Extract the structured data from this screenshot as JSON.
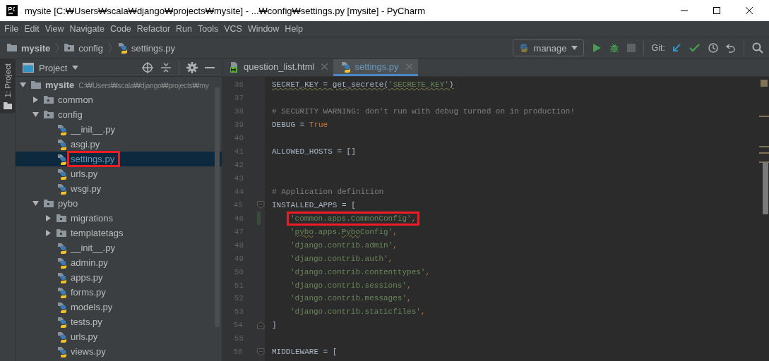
{
  "window": {
    "title": "mysite [C:₩Users₩scala₩django₩projects₩mysite] - ...₩config₩settings.py [mysite] - PyCharm"
  },
  "menu": [
    "File",
    "Edit",
    "View",
    "Navigate",
    "Code",
    "Refactor",
    "Run",
    "Tools",
    "VCS",
    "Window",
    "Help"
  ],
  "breadcrumbs": [
    {
      "label": "mysite",
      "kind": "project"
    },
    {
      "label": "config",
      "kind": "folder"
    },
    {
      "label": "settings.py",
      "kind": "python"
    }
  ],
  "run_config": {
    "label": "manage"
  },
  "git_label": "Git:",
  "tool_stripe": {
    "label": "1: Project",
    "selected": true
  },
  "project_panel": {
    "title": "Project",
    "tree": [
      {
        "label": "mysite",
        "kind": "root",
        "path": "C:₩Users₩scala₩django₩projects₩my",
        "expanded": true,
        "selected": false,
        "children": [
          {
            "label": "common",
            "kind": "folder",
            "expanded": false,
            "selected": false
          },
          {
            "label": "config",
            "kind": "folder",
            "expanded": true,
            "selected": false,
            "children": [
              {
                "label": "__init__.py",
                "kind": "python",
                "selected": false
              },
              {
                "label": "asgi.py",
                "kind": "python",
                "selected": false
              },
              {
                "label": "settings.py",
                "kind": "python",
                "selected": true,
                "annotated": true
              },
              {
                "label": "urls.py",
                "kind": "python",
                "selected": false
              },
              {
                "label": "wsgi.py",
                "kind": "python",
                "selected": false
              }
            ]
          },
          {
            "label": "pybo",
            "kind": "folder",
            "expanded": true,
            "selected": false,
            "children": [
              {
                "label": "migrations",
                "kind": "folder",
                "expanded": false,
                "selected": false
              },
              {
                "label": "templatetags",
                "kind": "folder",
                "expanded": false,
                "selected": false
              },
              {
                "label": "__init__.py",
                "kind": "python",
                "selected": false
              },
              {
                "label": "admin.py",
                "kind": "python",
                "selected": false
              },
              {
                "label": "apps.py",
                "kind": "python",
                "selected": false
              },
              {
                "label": "forms.py",
                "kind": "python",
                "selected": false
              },
              {
                "label": "models.py",
                "kind": "python",
                "selected": false
              },
              {
                "label": "tests.py",
                "kind": "python",
                "selected": false
              },
              {
                "label": "urls.py",
                "kind": "python",
                "selected": false
              },
              {
                "label": "views.py",
                "kind": "python",
                "selected": false
              }
            ]
          }
        ]
      }
    ]
  },
  "tabs": [
    {
      "label": "question_list.html",
      "kind": "html",
      "selected": false
    },
    {
      "label": "settings.py",
      "kind": "python",
      "selected": true
    }
  ],
  "editor": {
    "lines": [
      {
        "number": "36",
        "segments": [
          {
            "text": "SECRET_KEY = get_secrete(",
            "kind": "plain",
            "wavy": true
          },
          {
            "text": "'SECRETE_KEY'",
            "kind": "string",
            "wavy": true
          },
          {
            "text": ")",
            "kind": "plain",
            "wavy": true
          }
        ]
      },
      {
        "number": "37"
      },
      {
        "number": "38",
        "segments": [
          {
            "text": "# SECURITY WARNING: don't run with debug turned on in production!",
            "kind": "comment"
          }
        ]
      },
      {
        "number": "39",
        "segments": [
          {
            "text": "DEBUG = ",
            "kind": "plain"
          },
          {
            "text": "True",
            "kind": "keyword"
          }
        ]
      },
      {
        "number": "40"
      },
      {
        "number": "41",
        "segments": [
          {
            "text": "ALLOWED_HOSTS = []",
            "kind": "plain"
          }
        ]
      },
      {
        "number": "42"
      },
      {
        "number": "43"
      },
      {
        "number": "44",
        "segments": [
          {
            "text": "# Application definition",
            "kind": "comment"
          }
        ]
      },
      {
        "number": "45",
        "fold_start": true,
        "segments": [
          {
            "text": "INSTALLED_APPS = [",
            "kind": "plain"
          }
        ]
      },
      {
        "number": "46",
        "changed": true,
        "annotated": true,
        "indented": true,
        "segments": [
          {
            "text": "'common.apps.CommonConfig'",
            "kind": "string"
          },
          {
            "text": ",",
            "kind": "punct"
          }
        ]
      },
      {
        "number": "47",
        "indented": true,
        "segments": [
          {
            "text": "'",
            "kind": "string"
          },
          {
            "text": "pybo",
            "kind": "string",
            "wavy": true
          },
          {
            "text": ".apps.",
            "kind": "string"
          },
          {
            "text": "Pybo",
            "kind": "string",
            "wavy": true
          },
          {
            "text": "Config'",
            "kind": "string"
          },
          {
            "text": ",",
            "kind": "punct"
          }
        ]
      },
      {
        "number": "48",
        "indented": true,
        "segments": [
          {
            "text": "'django.contrib.admin'",
            "kind": "string"
          },
          {
            "text": ",",
            "kind": "punct"
          }
        ]
      },
      {
        "number": "49",
        "indented": true,
        "segments": [
          {
            "text": "'django.contrib.auth'",
            "kind": "string"
          },
          {
            "text": ",",
            "kind": "punct"
          }
        ]
      },
      {
        "number": "50",
        "indented": true,
        "segments": [
          {
            "text": "'django.contrib.contenttypes'",
            "kind": "string"
          },
          {
            "text": ",",
            "kind": "punct"
          }
        ]
      },
      {
        "number": "51",
        "indented": true,
        "segments": [
          {
            "text": "'django.contrib.sessions'",
            "kind": "string"
          },
          {
            "text": ",",
            "kind": "punct"
          }
        ]
      },
      {
        "number": "52",
        "indented": true,
        "segments": [
          {
            "text": "'django.contrib.messages'",
            "kind": "string"
          },
          {
            "text": ",",
            "kind": "punct"
          }
        ]
      },
      {
        "number": "53",
        "indented": true,
        "segments": [
          {
            "text": "'django.contrib.staticfiles'",
            "kind": "string"
          },
          {
            "text": ",",
            "kind": "punct"
          }
        ]
      },
      {
        "number": "54",
        "fold_end": true,
        "segments": [
          {
            "text": "]",
            "kind": "plain"
          }
        ]
      },
      {
        "number": "55"
      },
      {
        "number": "56",
        "fold_start": true,
        "segments": [
          {
            "text": "MIDDLEWARE = [",
            "kind": "plain"
          }
        ]
      }
    ]
  }
}
